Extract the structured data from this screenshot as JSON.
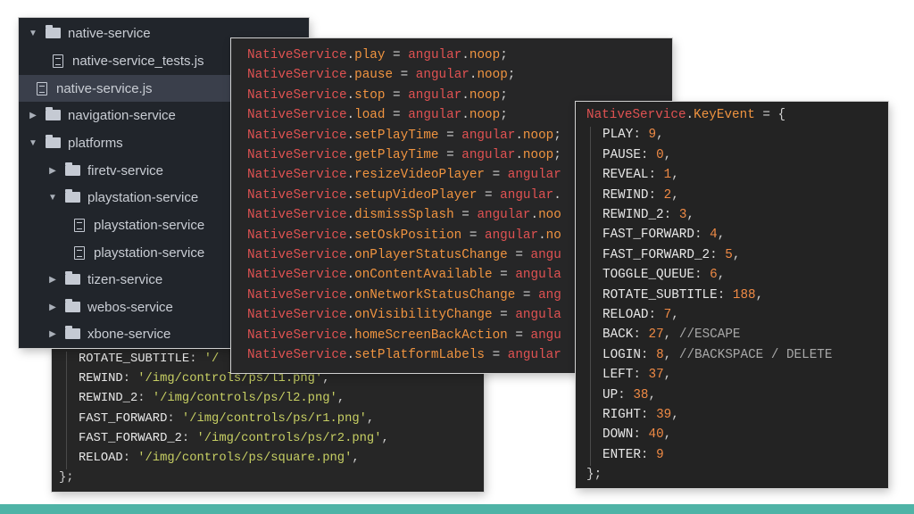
{
  "tree": {
    "rows": [
      {
        "label": "native-service",
        "kind": "folder",
        "state": "expanded"
      },
      {
        "label": "native-service_tests.js",
        "kind": "file"
      },
      {
        "label": "native-service.js",
        "kind": "file",
        "selected": true
      },
      {
        "label": "navigation-service",
        "kind": "folder",
        "state": "collapsed"
      },
      {
        "label": "platforms",
        "kind": "folder",
        "state": "expanded"
      },
      {
        "label": "firetv-service",
        "kind": "folder",
        "state": "collapsed"
      },
      {
        "label": "playstation-service",
        "kind": "folder",
        "state": "expanded"
      },
      {
        "label": "playstation-service",
        "kind": "file"
      },
      {
        "label": "playstation-service",
        "kind": "file"
      },
      {
        "label": "tizen-service",
        "kind": "folder",
        "state": "collapsed"
      },
      {
        "label": "webos-service",
        "kind": "folder",
        "state": "collapsed"
      },
      {
        "label": "xbone-service",
        "kind": "folder",
        "state": "collapsed"
      }
    ]
  },
  "code_back": {
    "lines": [
      {
        "key": "ROTATE_SUBTITLE",
        "value": "'/"
      },
      {
        "key": "REWIND",
        "value": "'/img/controls/ps/l1.png'"
      },
      {
        "key": "REWIND_2",
        "value": "'/img/controls/ps/l2.png'"
      },
      {
        "key": "FAST_FORWARD",
        "value": "'/img/controls/ps/r1.png'"
      },
      {
        "key": "FAST_FORWARD_2",
        "value": "'/img/controls/ps/r2.png'"
      },
      {
        "key": "RELOAD",
        "value": "'/img/controls/ps/square.png'"
      }
    ],
    "closing": "};"
  },
  "code_native": {
    "object": "NativeService",
    "rhs_obj": "angular",
    "rhs_fn": "noop",
    "lines": [
      {
        "method": "play",
        "rhs": "angular.noop;"
      },
      {
        "method": "pause",
        "rhs": "angular.noop;"
      },
      {
        "method": "stop",
        "rhs": "angular.noop;"
      },
      {
        "method": "load",
        "rhs": "angular.noop;"
      },
      {
        "method": "setPlayTime",
        "rhs": "angular.noop;"
      },
      {
        "method": "getPlayTime",
        "rhs": "angular.noop;"
      },
      {
        "method": "resizeVideoPlayer",
        "rhs": "angular"
      },
      {
        "method": "setupVideoPlayer",
        "rhs": "angular."
      },
      {
        "method": "dismissSplash",
        "rhs": "angular.noo"
      },
      {
        "method": "setOskPosition",
        "rhs": "angular.no"
      },
      {
        "method": "onPlayerStatusChange",
        "rhs": "angu"
      },
      {
        "method": "onContentAvailable",
        "rhs": "angula"
      },
      {
        "method": "onNetworkStatusChange",
        "rhs": "ang"
      },
      {
        "method": "onVisibilityChange",
        "rhs": "angula"
      },
      {
        "method": "homeScreenBackAction",
        "rhs": "angu"
      },
      {
        "method": "setPlatformLabels",
        "rhs": "angular"
      }
    ]
  },
  "code_keyevent": {
    "header_obj": "NativeService",
    "header_prop": "KeyEvent",
    "entries": [
      {
        "key": "PLAY",
        "value": "9",
        "comment": ""
      },
      {
        "key": "PAUSE",
        "value": "0",
        "comment": ""
      },
      {
        "key": "REVEAL",
        "value": "1",
        "comment": ""
      },
      {
        "key": "REWIND",
        "value": "2",
        "comment": ""
      },
      {
        "key": "REWIND_2",
        "value": "3",
        "comment": ""
      },
      {
        "key": "FAST_FORWARD",
        "value": "4",
        "comment": ""
      },
      {
        "key": "FAST_FORWARD_2",
        "value": "5",
        "comment": ""
      },
      {
        "key": "TOGGLE_QUEUE",
        "value": "6",
        "comment": ""
      },
      {
        "key": "ROTATE_SUBTITLE",
        "value": "188",
        "comment": ""
      },
      {
        "key": "RELOAD",
        "value": "7",
        "comment": ""
      },
      {
        "key": "BACK",
        "value": "27",
        "comment": "//ESCAPE"
      },
      {
        "key": "LOGIN",
        "value": "8",
        "comment": "//BACKSPACE / DELETE"
      },
      {
        "key": "LEFT",
        "value": "37",
        "comment": ""
      },
      {
        "key": "UP",
        "value": "38",
        "comment": ""
      },
      {
        "key": "RIGHT",
        "value": "39",
        "comment": ""
      },
      {
        "key": "DOWN",
        "value": "40",
        "comment": ""
      },
      {
        "key": "ENTER",
        "value": "9",
        "comment": ""
      }
    ],
    "closing": "};"
  },
  "colors": {
    "teal_bar": "#4fb3a6",
    "keyword_red": "#e05252",
    "number_orange": "#ef8a45",
    "string_yellow": "#c7cf63"
  }
}
